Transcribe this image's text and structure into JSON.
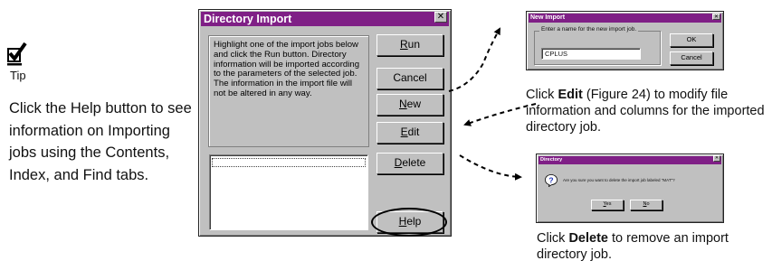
{
  "tip": {
    "label": "Tip",
    "text": "Click the Help button to see information on Importing jobs using the Contents, Index, and Find tabs."
  },
  "directory_import": {
    "title": "Directory Import",
    "close_glyph": "✕",
    "instructions": "Highlight one of the import jobs below and click the Run button. Directory information will be imported according to the parameters of the selected job. The information in the import file will not be altered in any way.",
    "buttons": {
      "run": {
        "mnemonic": "R",
        "rest": "un"
      },
      "cancel": {
        "label": "Cancel"
      },
      "new": {
        "mnemonic": "N",
        "rest": "ew"
      },
      "edit": {
        "mnemonic": "E",
        "rest": "dit"
      },
      "delete": {
        "mnemonic": "D",
        "rest": "elete"
      },
      "help": {
        "mnemonic": "H",
        "rest": "elp"
      }
    }
  },
  "new_import": {
    "title": "New Import",
    "close_glyph": "✕",
    "prompt": "Enter a name for the new import job.",
    "input_value": "CPLUS",
    "ok_label": "OK",
    "cancel_label": "Cancel"
  },
  "confirm_delete": {
    "title": "Directory",
    "close_glyph": "✕",
    "message": "Are you sure you want to delete the import job labeled \"MAT\"?",
    "yes": {
      "mnemonic": "Y",
      "rest": "es"
    },
    "no": {
      "mnemonic": "N",
      "rest": "o"
    }
  },
  "captions": {
    "edit": {
      "prefix": "Click ",
      "bold": "Edit",
      "suffix": " (Figure 24) to modify file information and columns for the imported directory job."
    },
    "delete": {
      "prefix": "Click ",
      "bold": "Delete",
      "suffix": " to remove an import directory job."
    }
  },
  "colors": {
    "titlebar": "#7f1f86",
    "dialog_face": "#c0c0c0"
  },
  "icons": [
    "checkmark-tip-icon",
    "question-icon",
    "close-icon"
  ]
}
